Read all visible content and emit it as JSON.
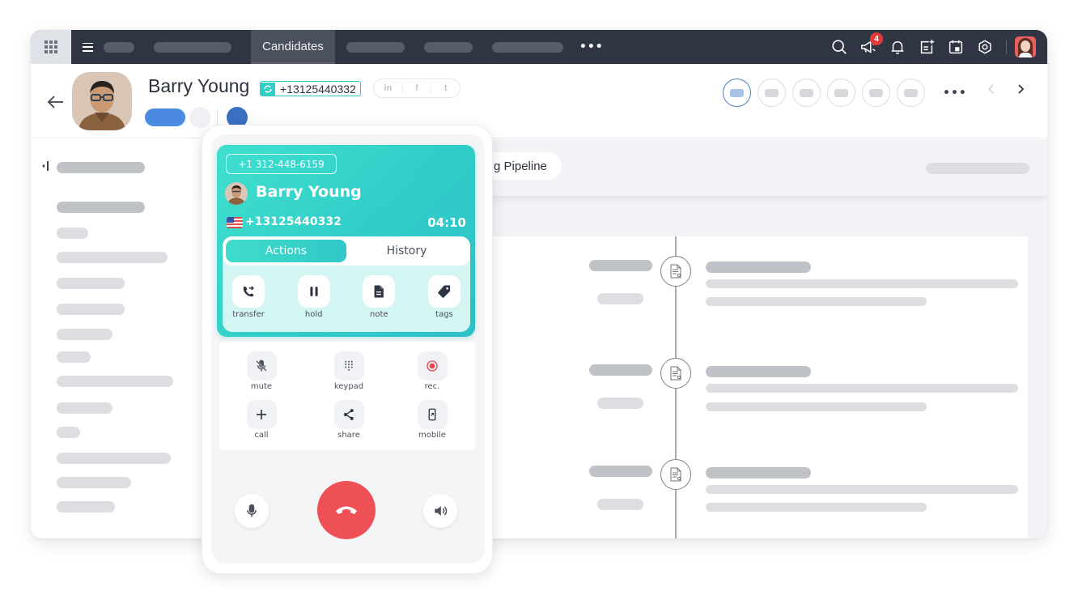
{
  "topbar": {
    "active_tab": "Candidates",
    "nav_placeholders": 6,
    "more_label": "•••",
    "icons": [
      "search-icon",
      "megaphone-icon",
      "bell-icon",
      "add-note-icon",
      "calendar-icon",
      "settings-icon"
    ],
    "notification_count": "4"
  },
  "profile": {
    "name": "Barry Young",
    "phone": "+13125440332",
    "social": [
      "in",
      "f",
      "t"
    ],
    "stage_count": 6,
    "active_stage_index": 0,
    "stages_more_label": "•••"
  },
  "pipeline": {
    "label": "g Pipeline"
  },
  "timeline": {
    "entries": 3
  },
  "phone_widget": {
    "caller_id": "+1 312-448-6159",
    "caller_name": "Barry Young",
    "caller_number": "+13125440332",
    "call_duration": "04:10",
    "tabs": [
      {
        "label": "Actions",
        "active": true
      },
      {
        "label": "History",
        "active": false
      }
    ],
    "actions": [
      {
        "label": "transfer",
        "icon": "transfer-icon"
      },
      {
        "label": "hold",
        "icon": "pause-icon"
      },
      {
        "label": "note",
        "icon": "note-icon"
      },
      {
        "label": "tags",
        "icon": "tag-icon"
      }
    ],
    "controls": [
      {
        "label": "mute",
        "icon": "mic-off-icon"
      },
      {
        "label": "keypad",
        "icon": "keypad-icon"
      },
      {
        "label": "rec.",
        "icon": "record-icon"
      },
      {
        "label": "call",
        "icon": "plus-icon"
      },
      {
        "label": "share",
        "icon": "share-icon"
      },
      {
        "label": "mobile",
        "icon": "mobile-icon"
      }
    ],
    "colors": {
      "accent": "#30cdc8",
      "hangup": "#ef5055",
      "record": "#e8474c"
    }
  }
}
